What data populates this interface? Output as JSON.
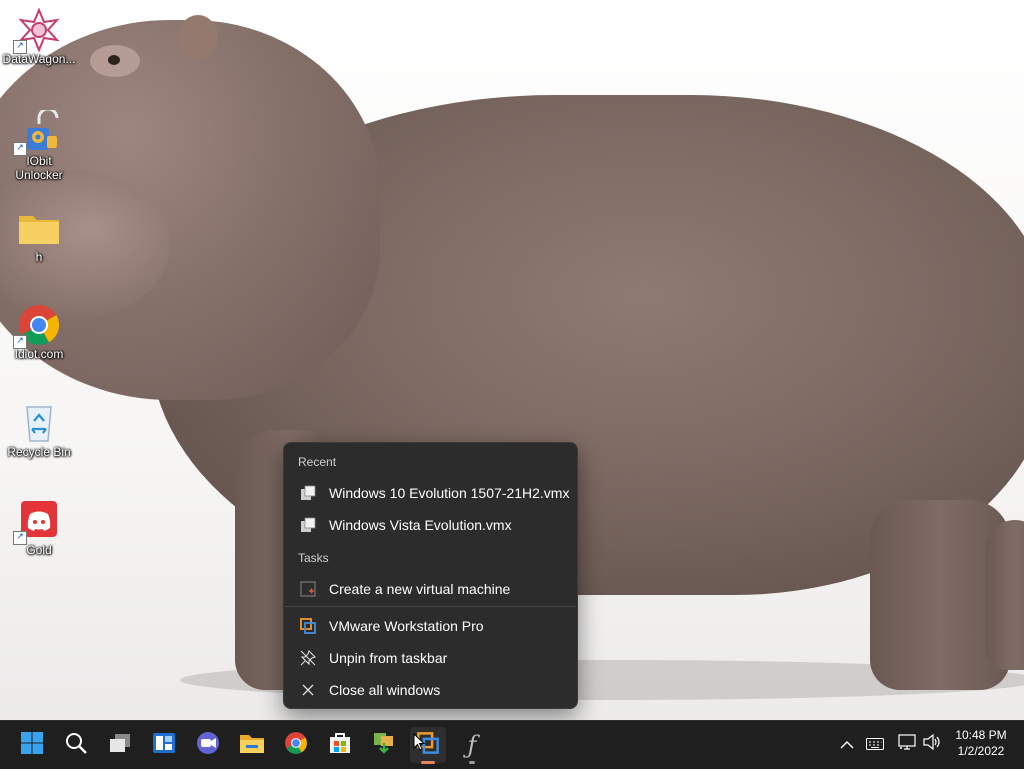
{
  "desktop": {
    "icons": [
      {
        "label": "DataWagon...",
        "icon": "datawagon-icon"
      },
      {
        "label": "IObit\nUnlocker",
        "icon": "iobit-unlocker-icon"
      },
      {
        "label": "h",
        "icon": "folder-icon"
      },
      {
        "label": "Idiot.com",
        "icon": "chrome-icon"
      },
      {
        "label": "Recycle Bin",
        "icon": "recycle-bin-icon"
      },
      {
        "label": "Gold",
        "icon": "discord-icon"
      }
    ],
    "wallpaper": "hippopotamus"
  },
  "jumplist": {
    "recent_header": "Recent",
    "recent": [
      {
        "label": "Windows 10 Evolution 1507-21H2.vmx",
        "icon": "vmx-file-icon"
      },
      {
        "label": "Windows Vista Evolution.vmx",
        "icon": "vmx-file-icon"
      }
    ],
    "tasks_header": "Tasks",
    "tasks": [
      {
        "label": "Create a new virtual machine",
        "icon": "new-vm-icon"
      }
    ],
    "app_items": [
      {
        "label": "VMware Workstation Pro",
        "icon": "vmware-icon"
      },
      {
        "label": "Unpin from taskbar",
        "icon": "unpin-icon"
      },
      {
        "label": "Close all windows",
        "icon": "close-icon"
      }
    ]
  },
  "taskbar": {
    "apps": [
      {
        "name": "Start",
        "icon": "windows-start-icon"
      },
      {
        "name": "Search",
        "icon": "search-icon"
      },
      {
        "name": "Task View",
        "icon": "task-view-icon"
      },
      {
        "name": "Widgets",
        "icon": "widgets-icon"
      },
      {
        "name": "Chat",
        "icon": "teams-chat-icon"
      },
      {
        "name": "File Explorer",
        "icon": "file-explorer-icon"
      },
      {
        "name": "Google Chrome",
        "icon": "chrome-icon"
      },
      {
        "name": "Microsoft Store",
        "icon": "store-icon"
      },
      {
        "name": "Installer",
        "icon": "installer-icon"
      },
      {
        "name": "VMware Workstation Pro",
        "icon": "vmware-icon",
        "active": true
      },
      {
        "name": "App",
        "icon": "script-f-icon",
        "running": true
      }
    ],
    "tray": {
      "icons": [
        "chevron-up-icon",
        "keyboard-icon",
        "network-icon",
        "volume-icon"
      ],
      "time": "10:48 PM",
      "date": "1/2/2022"
    }
  },
  "colors": {
    "taskbar_bg": "#1f1f1f",
    "menu_bg": "#2c2c2c",
    "active_indicator": "#e8855f"
  }
}
